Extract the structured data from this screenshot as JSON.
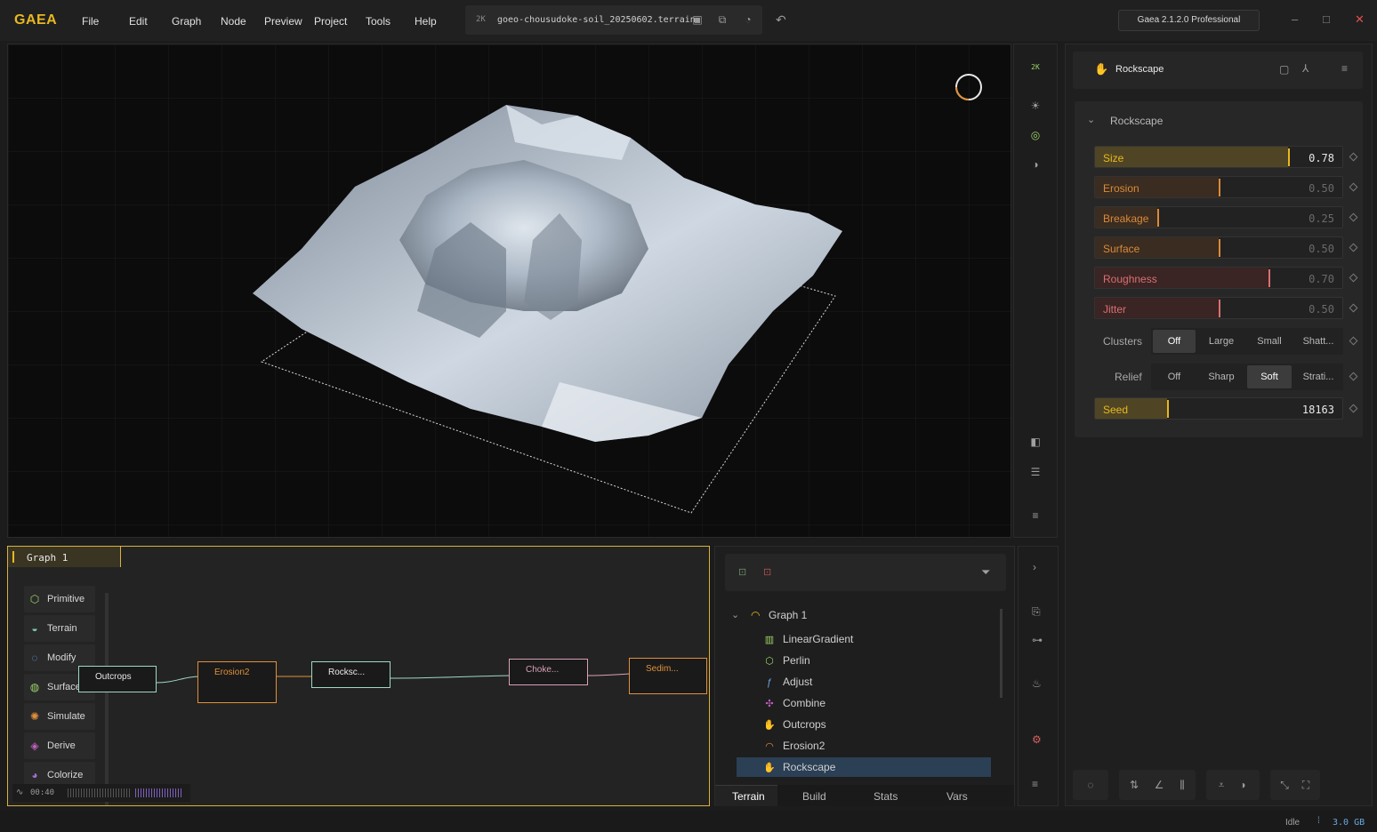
{
  "app": {
    "logo": "GAEA",
    "menu": [
      "File",
      "Edit",
      "Graph",
      "Node",
      "Preview",
      "Project",
      "Tools",
      "Help"
    ],
    "resolution_badge": "2K",
    "file_name": "goeo-chousudoke-soil_20250602.terrain",
    "version": "Gaea 2.1.2.0 Professional"
  },
  "viewport": {
    "resolution_badge": "2K"
  },
  "properties": {
    "node_title": "Rockscape",
    "section_title": "Rockscape",
    "sliders": [
      {
        "label": "Size",
        "value": "0.78",
        "fraction": 0.78,
        "color": "#e8b820",
        "fill": "#4f4525"
      },
      {
        "label": "Erosion",
        "value": "0.50",
        "fraction": 0.5,
        "color": "#d98a3a",
        "fill": "#3a2c20"
      },
      {
        "label": "Breakage",
        "value": "0.25",
        "fraction": 0.25,
        "color": "#d98a3a",
        "fill": "#3a2c20"
      },
      {
        "label": "Surface",
        "value": "0.50",
        "fraction": 0.5,
        "color": "#d98a3a",
        "fill": "#3a2c20"
      },
      {
        "label": "Roughness",
        "value": "0.70",
        "fraction": 0.7,
        "color": "#d97070",
        "fill": "#3a2424"
      },
      {
        "label": "Jitter",
        "value": "0.50",
        "fraction": 0.5,
        "color": "#d97070",
        "fill": "#3a2424"
      }
    ],
    "clusters": {
      "label": "Clusters",
      "options": [
        "Off",
        "Large",
        "Small",
        "Shatt..."
      ],
      "selected": "Off"
    },
    "relief": {
      "label": "Relief",
      "options": [
        "Off",
        "Sharp",
        "Soft",
        "Strati..."
      ],
      "selected": "Soft"
    },
    "seed": {
      "label": "Seed",
      "value": "18163",
      "fraction": 0.29
    }
  },
  "graph": {
    "tab_label": "Graph 1",
    "categories": [
      {
        "label": "Primitive",
        "icon": "cube-icon",
        "color": "#9bd36a"
      },
      {
        "label": "Terrain",
        "icon": "terrain-icon",
        "color": "#7fc8b8"
      },
      {
        "label": "Modify",
        "icon": "modify-icon",
        "color": "#6aa8e0"
      },
      {
        "label": "Surface",
        "icon": "surface-icon",
        "color": "#9bd36a"
      },
      {
        "label": "Simulate",
        "icon": "simulate-icon",
        "color": "#e0903a"
      },
      {
        "label": "Derive",
        "icon": "derive-icon",
        "color": "#c060c0"
      },
      {
        "label": "Colorize",
        "icon": "colorize-icon",
        "color": "#a070d0"
      }
    ],
    "nodes": [
      {
        "label": "Outcrops",
        "color": "#9fd8c4"
      },
      {
        "label": "Erosion2",
        "color": "#e0903a"
      },
      {
        "label": "Rocksc...",
        "color": "#9fd8c4"
      },
      {
        "label": "Choke...",
        "color": "#d8a0b8"
      },
      {
        "label": "Sedim...",
        "color": "#e0903a"
      }
    ],
    "timeline": "00:40"
  },
  "tree": {
    "root": "Graph 1",
    "items": [
      {
        "label": "LinearGradient",
        "icon": "gradient-icon",
        "color": "#9bd36a"
      },
      {
        "label": "Perlin",
        "icon": "hexagon-icon",
        "color": "#9bd36a"
      },
      {
        "label": "Adjust",
        "icon": "fx-icon",
        "color": "#6aa8e0"
      },
      {
        "label": "Combine",
        "icon": "combine-icon",
        "color": "#c060c0"
      },
      {
        "label": "Outcrops",
        "icon": "hand-icon",
        "color": "#7fc8b8"
      },
      {
        "label": "Erosion2",
        "icon": "erosion-icon",
        "color": "#e0903a"
      },
      {
        "label": "Rockscape",
        "icon": "hand-icon",
        "color": "#7fc8b8"
      }
    ],
    "tabs": [
      "Terrain",
      "Build",
      "Stats",
      "Vars"
    ],
    "active_tab": "Terrain"
  },
  "status": {
    "state": "Idle",
    "memory": "3.0 GB"
  }
}
